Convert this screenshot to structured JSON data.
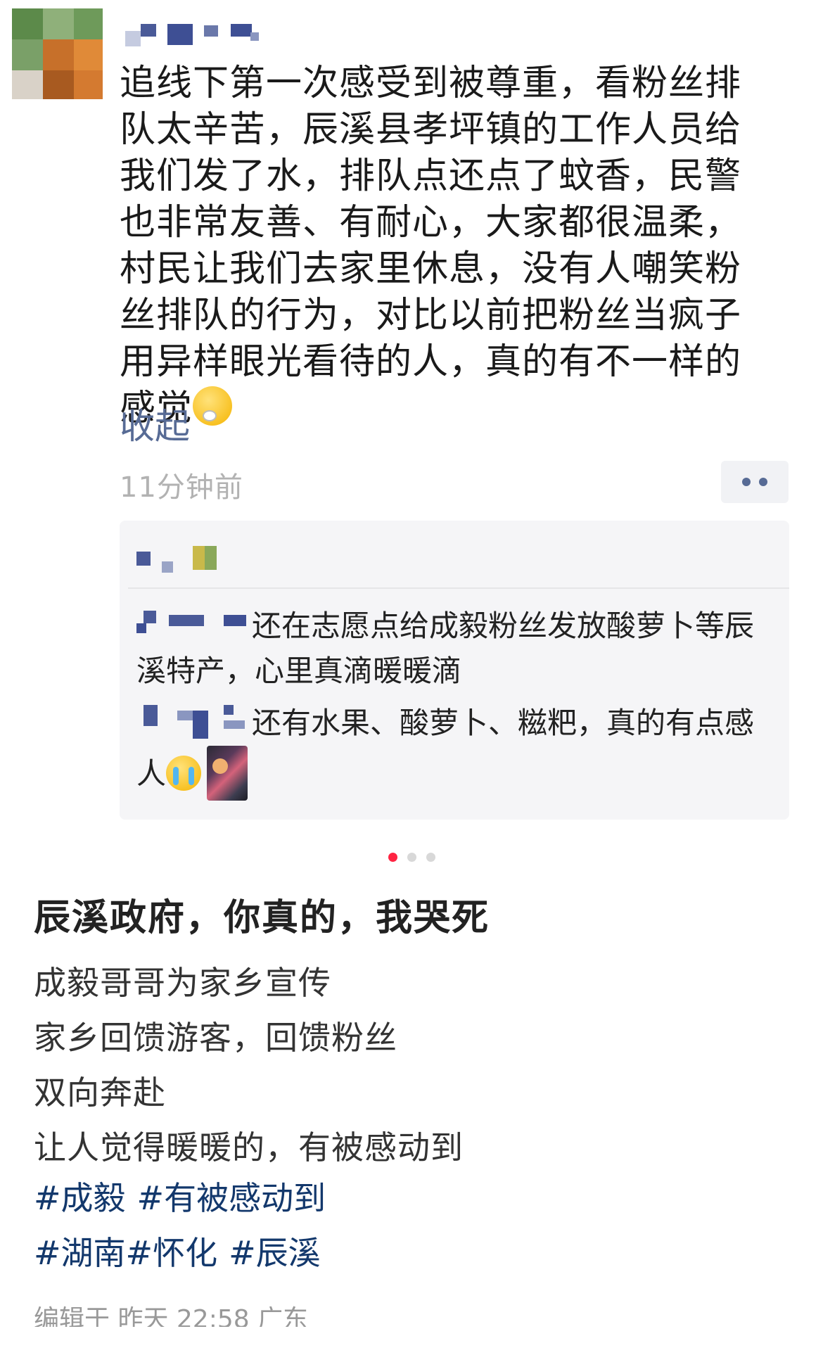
{
  "post": {
    "text": "追线下第一次感受到被尊重，看粉丝排队太辛苦，辰溪县孝坪镇的工作人员给我们发了水，排队点还点了蚊香，民警也非常友善、有耐心，大家都很温柔，村民让我们去家里休息，没有人嘲笑粉丝排队的行为，对比以前把粉丝当疯子用异样眼光看待的人，真的有不一样的感觉",
    "collapse_label": "收起",
    "time": "11分钟前"
  },
  "comments": [
    {
      "text": "还在志愿点给成毅粉丝发放酸萝卜等辰溪特产，心里真滴暖暖滴"
    },
    {
      "text": "还有水果、酸萝卜、糍粑，真的有点感人"
    }
  ],
  "carousel": {
    "count": 3,
    "active_index": 0,
    "active_color": "#ff2442"
  },
  "note": {
    "title": "辰溪政府，你真的，我哭死",
    "lines": [
      "成毅哥哥为家乡宣传",
      "家乡回馈游客，回馈粉丝",
      "双向奔赴",
      "让人觉得暖暖的，有被感动到"
    ],
    "tags_row1": [
      "#成毅",
      "#有被感动到"
    ],
    "tags_row2": [
      "#湖南",
      "#怀化",
      "#辰溪"
    ],
    "footer": "编辑于 昨天 22:58 广东"
  },
  "colors": {
    "link": "#576b95",
    "tag": "#13386c",
    "accent": "#ff2442"
  }
}
